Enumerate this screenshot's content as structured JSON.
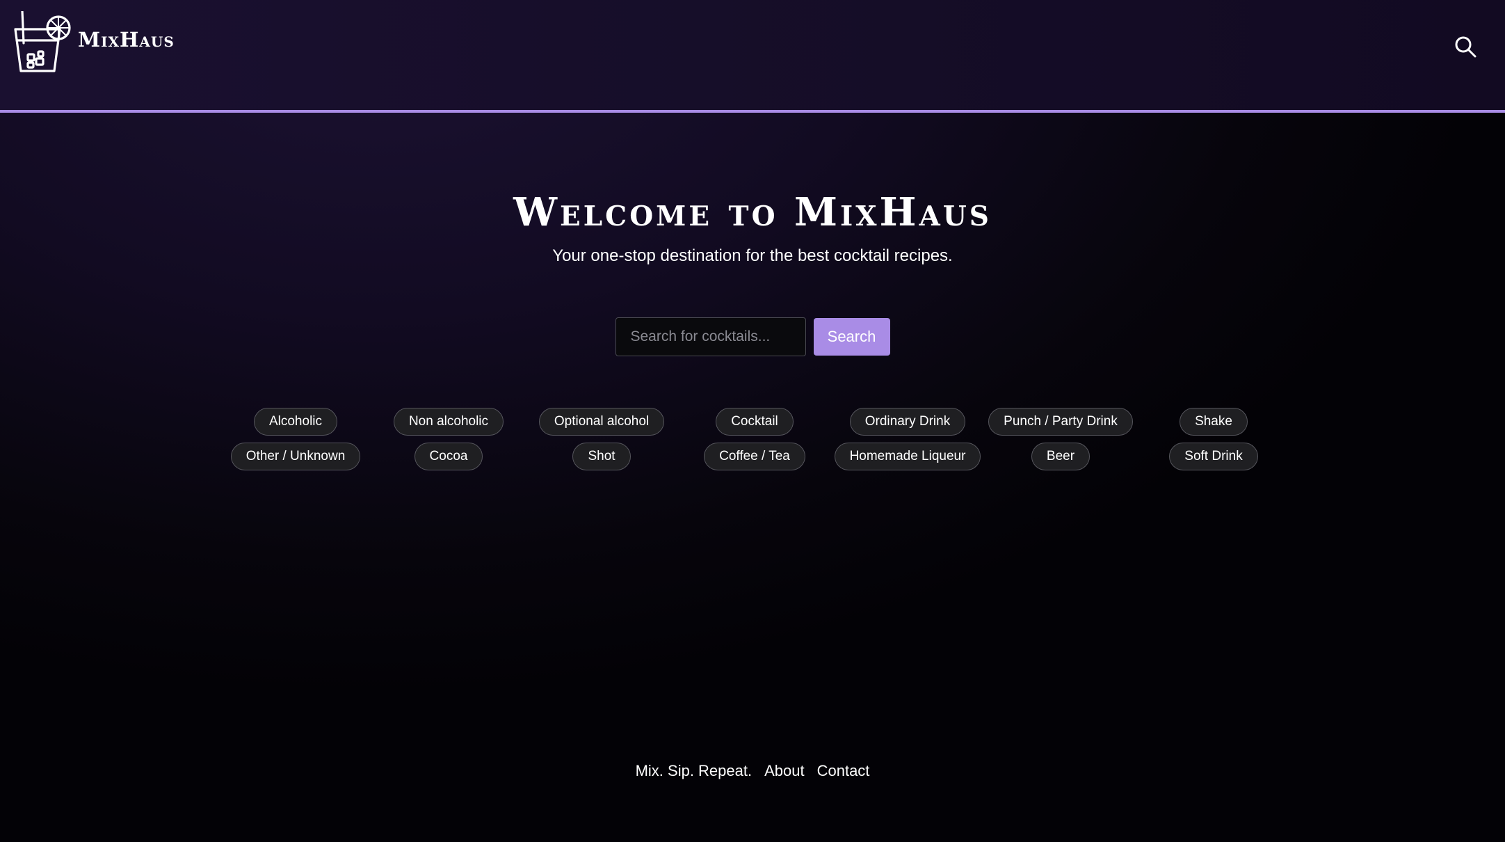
{
  "header": {
    "brand": "MixHaus"
  },
  "hero": {
    "title": "Welcome to MixHaus",
    "subtitle": "Your one-stop destination for the best cocktail recipes."
  },
  "search": {
    "placeholder": "Search for cocktails...",
    "value": "",
    "button_label": "Search"
  },
  "categories": {
    "row1": [
      "Alcoholic",
      "Non alcoholic",
      "Optional alcohol",
      "Cocktail",
      "Ordinary Drink",
      "Punch / Party Drink",
      "Shake"
    ],
    "row2": [
      "Other / Unknown",
      "Cocoa",
      "Shot",
      "Coffee / Tea",
      "Homemade Liqueur",
      "Beer",
      "Soft Drink"
    ]
  },
  "footer": {
    "tagline": "Mix. Sip. Repeat.",
    "about": "About",
    "contact": "Contact"
  },
  "colors": {
    "accent": "#a98ce6",
    "chip_bg": "#1f1f22",
    "header_bg": "#1a1030"
  },
  "icons": {
    "logo": "cocktail-glass-icon",
    "header_search": "search-icon"
  }
}
